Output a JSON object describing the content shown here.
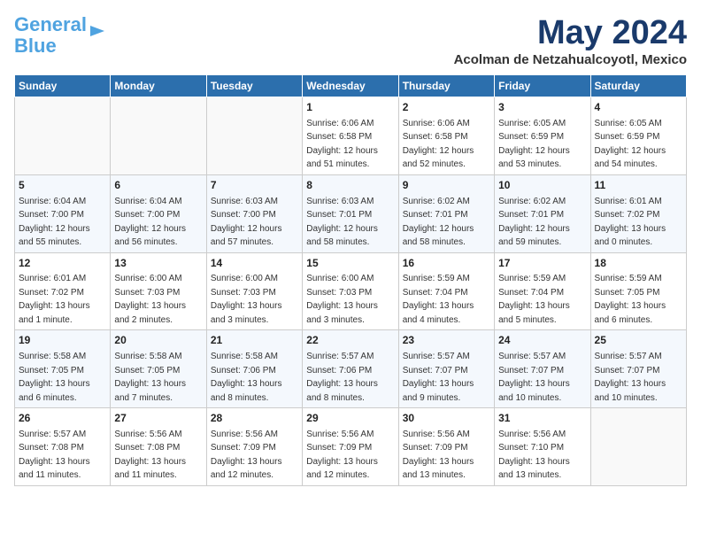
{
  "logo": {
    "line1": "General",
    "line2": "Blue"
  },
  "title": "May 2024",
  "subtitle": "Acolman de Netzahualcoyotl, Mexico",
  "headers": [
    "Sunday",
    "Monday",
    "Tuesday",
    "Wednesday",
    "Thursday",
    "Friday",
    "Saturday"
  ],
  "weeks": [
    [
      {
        "day": "",
        "info": ""
      },
      {
        "day": "",
        "info": ""
      },
      {
        "day": "",
        "info": ""
      },
      {
        "day": "1",
        "info": "Sunrise: 6:06 AM\nSunset: 6:58 PM\nDaylight: 12 hours\nand 51 minutes."
      },
      {
        "day": "2",
        "info": "Sunrise: 6:06 AM\nSunset: 6:58 PM\nDaylight: 12 hours\nand 52 minutes."
      },
      {
        "day": "3",
        "info": "Sunrise: 6:05 AM\nSunset: 6:59 PM\nDaylight: 12 hours\nand 53 minutes."
      },
      {
        "day": "4",
        "info": "Sunrise: 6:05 AM\nSunset: 6:59 PM\nDaylight: 12 hours\nand 54 minutes."
      }
    ],
    [
      {
        "day": "5",
        "info": "Sunrise: 6:04 AM\nSunset: 7:00 PM\nDaylight: 12 hours\nand 55 minutes."
      },
      {
        "day": "6",
        "info": "Sunrise: 6:04 AM\nSunset: 7:00 PM\nDaylight: 12 hours\nand 56 minutes."
      },
      {
        "day": "7",
        "info": "Sunrise: 6:03 AM\nSunset: 7:00 PM\nDaylight: 12 hours\nand 57 minutes."
      },
      {
        "day": "8",
        "info": "Sunrise: 6:03 AM\nSunset: 7:01 PM\nDaylight: 12 hours\nand 58 minutes."
      },
      {
        "day": "9",
        "info": "Sunrise: 6:02 AM\nSunset: 7:01 PM\nDaylight: 12 hours\nand 58 minutes."
      },
      {
        "day": "10",
        "info": "Sunrise: 6:02 AM\nSunset: 7:01 PM\nDaylight: 12 hours\nand 59 minutes."
      },
      {
        "day": "11",
        "info": "Sunrise: 6:01 AM\nSunset: 7:02 PM\nDaylight: 13 hours\nand 0 minutes."
      }
    ],
    [
      {
        "day": "12",
        "info": "Sunrise: 6:01 AM\nSunset: 7:02 PM\nDaylight: 13 hours\nand 1 minute."
      },
      {
        "day": "13",
        "info": "Sunrise: 6:00 AM\nSunset: 7:03 PM\nDaylight: 13 hours\nand 2 minutes."
      },
      {
        "day": "14",
        "info": "Sunrise: 6:00 AM\nSunset: 7:03 PM\nDaylight: 13 hours\nand 3 minutes."
      },
      {
        "day": "15",
        "info": "Sunrise: 6:00 AM\nSunset: 7:03 PM\nDaylight: 13 hours\nand 3 minutes."
      },
      {
        "day": "16",
        "info": "Sunrise: 5:59 AM\nSunset: 7:04 PM\nDaylight: 13 hours\nand 4 minutes."
      },
      {
        "day": "17",
        "info": "Sunrise: 5:59 AM\nSunset: 7:04 PM\nDaylight: 13 hours\nand 5 minutes."
      },
      {
        "day": "18",
        "info": "Sunrise: 5:59 AM\nSunset: 7:05 PM\nDaylight: 13 hours\nand 6 minutes."
      }
    ],
    [
      {
        "day": "19",
        "info": "Sunrise: 5:58 AM\nSunset: 7:05 PM\nDaylight: 13 hours\nand 6 minutes."
      },
      {
        "day": "20",
        "info": "Sunrise: 5:58 AM\nSunset: 7:05 PM\nDaylight: 13 hours\nand 7 minutes."
      },
      {
        "day": "21",
        "info": "Sunrise: 5:58 AM\nSunset: 7:06 PM\nDaylight: 13 hours\nand 8 minutes."
      },
      {
        "day": "22",
        "info": "Sunrise: 5:57 AM\nSunset: 7:06 PM\nDaylight: 13 hours\nand 8 minutes."
      },
      {
        "day": "23",
        "info": "Sunrise: 5:57 AM\nSunset: 7:07 PM\nDaylight: 13 hours\nand 9 minutes."
      },
      {
        "day": "24",
        "info": "Sunrise: 5:57 AM\nSunset: 7:07 PM\nDaylight: 13 hours\nand 10 minutes."
      },
      {
        "day": "25",
        "info": "Sunrise: 5:57 AM\nSunset: 7:07 PM\nDaylight: 13 hours\nand 10 minutes."
      }
    ],
    [
      {
        "day": "26",
        "info": "Sunrise: 5:57 AM\nSunset: 7:08 PM\nDaylight: 13 hours\nand 11 minutes."
      },
      {
        "day": "27",
        "info": "Sunrise: 5:56 AM\nSunset: 7:08 PM\nDaylight: 13 hours\nand 11 minutes."
      },
      {
        "day": "28",
        "info": "Sunrise: 5:56 AM\nSunset: 7:09 PM\nDaylight: 13 hours\nand 12 minutes."
      },
      {
        "day": "29",
        "info": "Sunrise: 5:56 AM\nSunset: 7:09 PM\nDaylight: 13 hours\nand 12 minutes."
      },
      {
        "day": "30",
        "info": "Sunrise: 5:56 AM\nSunset: 7:09 PM\nDaylight: 13 hours\nand 13 minutes."
      },
      {
        "day": "31",
        "info": "Sunrise: 5:56 AM\nSunset: 7:10 PM\nDaylight: 13 hours\nand 13 minutes."
      },
      {
        "day": "",
        "info": ""
      }
    ]
  ]
}
